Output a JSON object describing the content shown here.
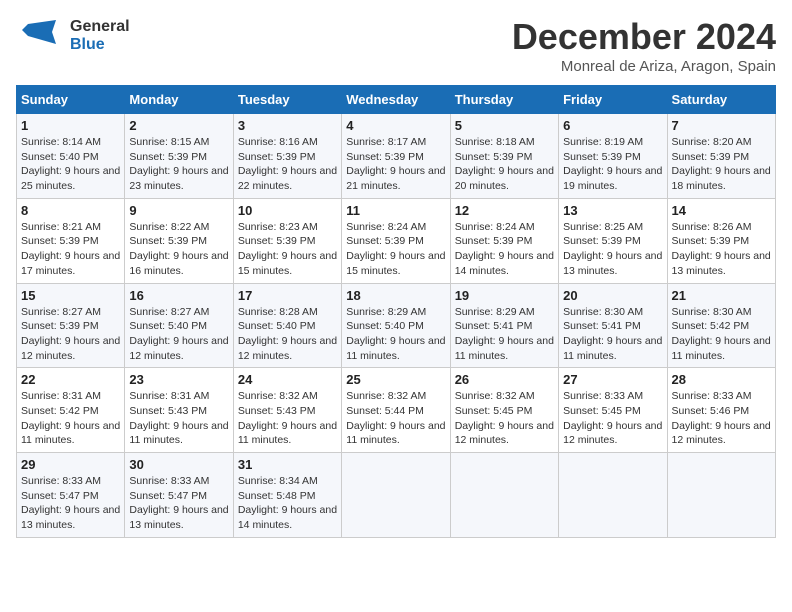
{
  "header": {
    "logo_general": "General",
    "logo_blue": "Blue",
    "month_title": "December 2024",
    "location": "Monreal de Ariza, Aragon, Spain"
  },
  "calendar": {
    "days_of_week": [
      "Sunday",
      "Monday",
      "Tuesday",
      "Wednesday",
      "Thursday",
      "Friday",
      "Saturday"
    ],
    "weeks": [
      [
        null,
        null,
        null,
        null,
        null,
        null,
        null
      ]
    ]
  },
  "cells": {
    "empty": "",
    "w1": [
      {
        "num": "1",
        "rise": "Sunrise: 8:14 AM",
        "set": "Sunset: 5:40 PM",
        "day": "Daylight: 9 hours and 25 minutes."
      },
      {
        "num": "2",
        "rise": "Sunrise: 8:15 AM",
        "set": "Sunset: 5:39 PM",
        "day": "Daylight: 9 hours and 23 minutes."
      },
      {
        "num": "3",
        "rise": "Sunrise: 8:16 AM",
        "set": "Sunset: 5:39 PM",
        "day": "Daylight: 9 hours and 22 minutes."
      },
      {
        "num": "4",
        "rise": "Sunrise: 8:17 AM",
        "set": "Sunset: 5:39 PM",
        "day": "Daylight: 9 hours and 21 minutes."
      },
      {
        "num": "5",
        "rise": "Sunrise: 8:18 AM",
        "set": "Sunset: 5:39 PM",
        "day": "Daylight: 9 hours and 20 minutes."
      },
      {
        "num": "6",
        "rise": "Sunrise: 8:19 AM",
        "set": "Sunset: 5:39 PM",
        "day": "Daylight: 9 hours and 19 minutes."
      },
      {
        "num": "7",
        "rise": "Sunrise: 8:20 AM",
        "set": "Sunset: 5:39 PM",
        "day": "Daylight: 9 hours and 18 minutes."
      }
    ],
    "w2": [
      {
        "num": "8",
        "rise": "Sunrise: 8:21 AM",
        "set": "Sunset: 5:39 PM",
        "day": "Daylight: 9 hours and 17 minutes."
      },
      {
        "num": "9",
        "rise": "Sunrise: 8:22 AM",
        "set": "Sunset: 5:39 PM",
        "day": "Daylight: 9 hours and 16 minutes."
      },
      {
        "num": "10",
        "rise": "Sunrise: 8:23 AM",
        "set": "Sunset: 5:39 PM",
        "day": "Daylight: 9 hours and 15 minutes."
      },
      {
        "num": "11",
        "rise": "Sunrise: 8:24 AM",
        "set": "Sunset: 5:39 PM",
        "day": "Daylight: 9 hours and 15 minutes."
      },
      {
        "num": "12",
        "rise": "Sunrise: 8:24 AM",
        "set": "Sunset: 5:39 PM",
        "day": "Daylight: 9 hours and 14 minutes."
      },
      {
        "num": "13",
        "rise": "Sunrise: 8:25 AM",
        "set": "Sunset: 5:39 PM",
        "day": "Daylight: 9 hours and 13 minutes."
      },
      {
        "num": "14",
        "rise": "Sunrise: 8:26 AM",
        "set": "Sunset: 5:39 PM",
        "day": "Daylight: 9 hours and 13 minutes."
      }
    ],
    "w3": [
      {
        "num": "15",
        "rise": "Sunrise: 8:27 AM",
        "set": "Sunset: 5:39 PM",
        "day": "Daylight: 9 hours and 12 minutes."
      },
      {
        "num": "16",
        "rise": "Sunrise: 8:27 AM",
        "set": "Sunset: 5:40 PM",
        "day": "Daylight: 9 hours and 12 minutes."
      },
      {
        "num": "17",
        "rise": "Sunrise: 8:28 AM",
        "set": "Sunset: 5:40 PM",
        "day": "Daylight: 9 hours and 12 minutes."
      },
      {
        "num": "18",
        "rise": "Sunrise: 8:29 AM",
        "set": "Sunset: 5:40 PM",
        "day": "Daylight: 9 hours and 11 minutes."
      },
      {
        "num": "19",
        "rise": "Sunrise: 8:29 AM",
        "set": "Sunset: 5:41 PM",
        "day": "Daylight: 9 hours and 11 minutes."
      },
      {
        "num": "20",
        "rise": "Sunrise: 8:30 AM",
        "set": "Sunset: 5:41 PM",
        "day": "Daylight: 9 hours and 11 minutes."
      },
      {
        "num": "21",
        "rise": "Sunrise: 8:30 AM",
        "set": "Sunset: 5:42 PM",
        "day": "Daylight: 9 hours and 11 minutes."
      }
    ],
    "w4": [
      {
        "num": "22",
        "rise": "Sunrise: 8:31 AM",
        "set": "Sunset: 5:42 PM",
        "day": "Daylight: 9 hours and 11 minutes."
      },
      {
        "num": "23",
        "rise": "Sunrise: 8:31 AM",
        "set": "Sunset: 5:43 PM",
        "day": "Daylight: 9 hours and 11 minutes."
      },
      {
        "num": "24",
        "rise": "Sunrise: 8:32 AM",
        "set": "Sunset: 5:43 PM",
        "day": "Daylight: 9 hours and 11 minutes."
      },
      {
        "num": "25",
        "rise": "Sunrise: 8:32 AM",
        "set": "Sunset: 5:44 PM",
        "day": "Daylight: 9 hours and 11 minutes."
      },
      {
        "num": "26",
        "rise": "Sunrise: 8:32 AM",
        "set": "Sunset: 5:45 PM",
        "day": "Daylight: 9 hours and 12 minutes."
      },
      {
        "num": "27",
        "rise": "Sunrise: 8:33 AM",
        "set": "Sunset: 5:45 PM",
        "day": "Daylight: 9 hours and 12 minutes."
      },
      {
        "num": "28",
        "rise": "Sunrise: 8:33 AM",
        "set": "Sunset: 5:46 PM",
        "day": "Daylight: 9 hours and 12 minutes."
      }
    ],
    "w5": [
      {
        "num": "29",
        "rise": "Sunrise: 8:33 AM",
        "set": "Sunset: 5:47 PM",
        "day": "Daylight: 9 hours and 13 minutes."
      },
      {
        "num": "30",
        "rise": "Sunrise: 8:33 AM",
        "set": "Sunset: 5:47 PM",
        "day": "Daylight: 9 hours and 13 minutes."
      },
      {
        "num": "31",
        "rise": "Sunrise: 8:34 AM",
        "set": "Sunset: 5:48 PM",
        "day": "Daylight: 9 hours and 14 minutes."
      },
      null,
      null,
      null,
      null
    ]
  }
}
